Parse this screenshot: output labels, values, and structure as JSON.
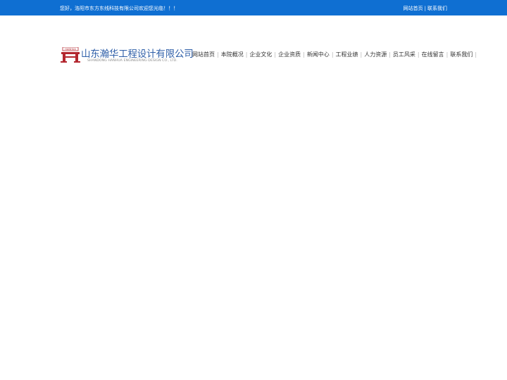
{
  "topbar": {
    "welcome": "您好，洛阳市东方东线科技有限公司欢迎您光临！！！",
    "links": [
      "网站首页",
      "联系我们"
    ],
    "separator": "|"
  },
  "logo": {
    "emblem_text": "HANHUA",
    "name_cn": "山东瀚华工程设计有限公司",
    "name_en": "SHANDONG HANHUA ENGINEERING DESIGN CO., LTD."
  },
  "nav": {
    "items": [
      "网站首页",
      "本院概况",
      "企业文化",
      "企业资质",
      "新闻中心",
      "工程业绩",
      "人力资源",
      "员工风采",
      "在线留言",
      "联系我们"
    ],
    "divider": "|"
  },
  "colors": {
    "topbar_bg": "#0f6fd2",
    "logo_emblem": "#b3262e",
    "logo_text": "#2f5fa8"
  }
}
